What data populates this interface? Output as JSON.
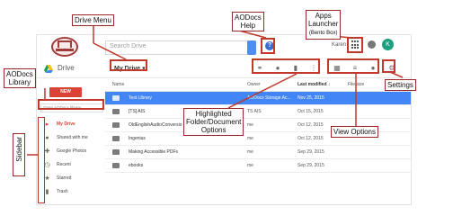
{
  "topbar": {
    "search_placeholder": "Search Drive",
    "user_name": "Karen",
    "avatar_initial": "K",
    "help_glyph": "?"
  },
  "subbar": {
    "app_title": "Drive",
    "location": "My Drive ▾"
  },
  "sidebar": {
    "new_label": "NEW",
    "open_aodocs_label": "Open AODocs library",
    "items": [
      {
        "label": "My Drive",
        "icon": "drive-folder-icon",
        "active": true
      },
      {
        "label": "Shared with me",
        "icon": "people-icon",
        "active": false
      },
      {
        "label": "Google Photos",
        "icon": "photos-icon",
        "active": false
      },
      {
        "label": "Recent",
        "icon": "clock-icon",
        "active": false
      },
      {
        "label": "Starred",
        "icon": "star-icon",
        "active": false
      },
      {
        "label": "Trash",
        "icon": "trash-icon",
        "active": false
      }
    ]
  },
  "files": {
    "columns": {
      "name": "Name",
      "owner": "Owner",
      "modified": "Last modified ↓",
      "size": "File size"
    },
    "rows": [
      {
        "name": "Test Library",
        "owner": "AODocs Storage Ac...",
        "modified": "Nov 25, 2015",
        "selected": true
      },
      {
        "name": "[TS] AIS",
        "owner": "TS AIS",
        "modified": "Oct 15, 2015",
        "selected": false
      },
      {
        "name": "OldEnglishAudioConversio",
        "owner": "me",
        "modified": "Oct 12, 2015",
        "selected": false
      },
      {
        "name": "Ingenius",
        "owner": "me",
        "modified": "Oct 12, 2015",
        "selected": false
      },
      {
        "name": "Making Accessible PDFs",
        "owner": "me",
        "modified": "Sep 29, 2015",
        "selected": false
      },
      {
        "name": "ebooks",
        "owner": "me",
        "modified": "Sep 29, 2015",
        "selected": false
      }
    ]
  },
  "annotations": {
    "drive_menu": "Drive Menu",
    "aodocs_help_1": "AODocs",
    "aodocs_help_2": "Help",
    "apps_launcher_1": "Apps",
    "apps_launcher_2": "Launcher",
    "apps_launcher_3": "(Bento Box)",
    "aodocs_library_1": "AODocs",
    "aodocs_library_2": "Library",
    "settings": "Settings",
    "highlighted_1": "Highlighted",
    "highlighted_2": "Folder/Document",
    "highlighted_3": "Options",
    "view_options": "View Options",
    "sidebar": "Sidebar"
  },
  "colors": {
    "annotation_red": "#c0392b",
    "selected_row": "#4285f4",
    "new_button": "#d94235",
    "avatar": "#1aa07e"
  }
}
